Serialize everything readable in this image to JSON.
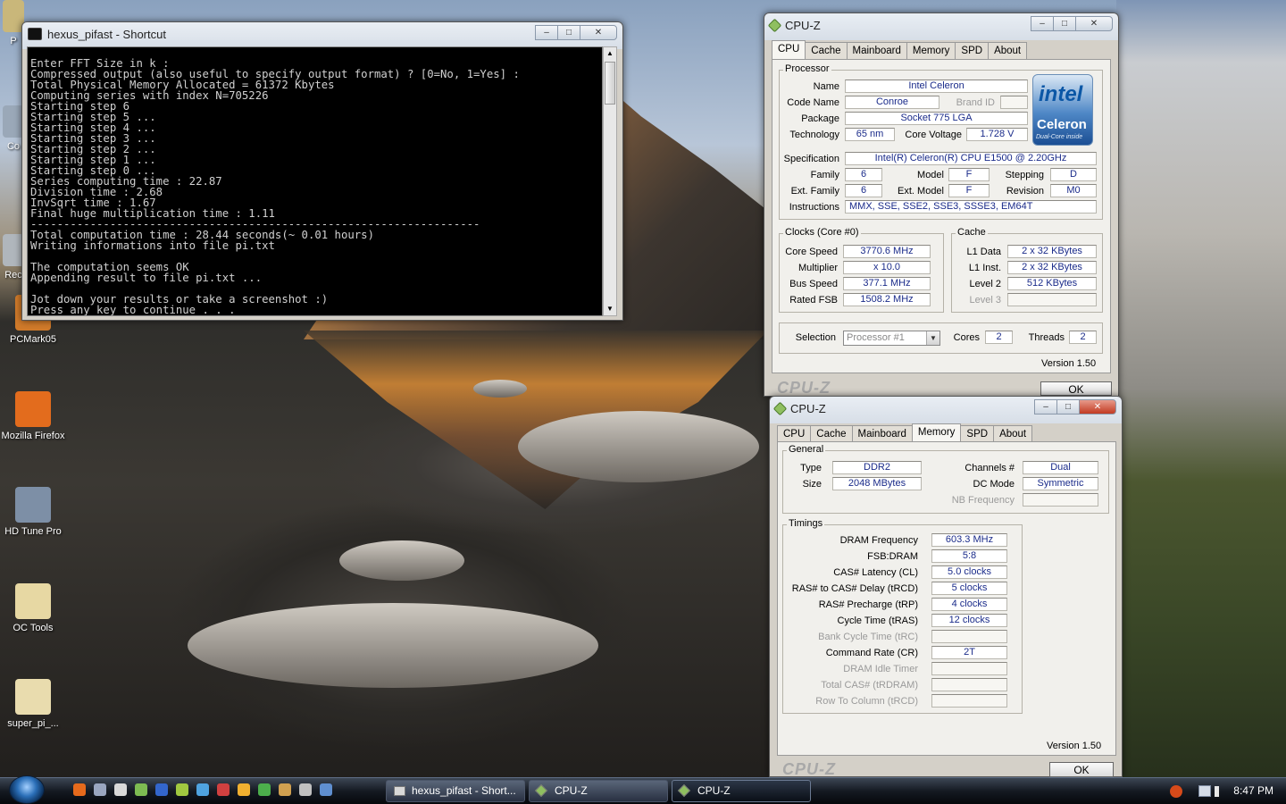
{
  "desktop": {
    "icons": [
      {
        "label": "P",
        "color": "#c9b77a"
      },
      {
        "label": "Co",
        "color": "#9aa8b8"
      },
      {
        "label": "Rec",
        "color": "#b0b6bc"
      },
      {
        "label": "PCMark05",
        "color": "#d07a2a"
      },
      {
        "label": "Mozilla Firefox",
        "color": "#e36c1d"
      },
      {
        "label": "HD Tune Pro",
        "color": "#7d8fa6"
      },
      {
        "label": "OC Tools",
        "color": "#e7d8a3"
      },
      {
        "label": "super_pi_...",
        "color": "#e9dcae"
      }
    ]
  },
  "console_window": {
    "title": "hexus_pifast - Shortcut",
    "lines": [
      "Enter FFT Size in k :",
      "Compressed output (also useful to specify output format) ? [0=No, 1=Yes] :",
      "Total Physical Memory Allocated = 61372 Kbytes",
      "Computing series with index N=705226",
      "Starting step 6",
      "Starting step 5 ...",
      "Starting step 4 ...",
      "Starting step 3 ...",
      "Starting step 2 ...",
      "Starting step 1 ...",
      "Starting step 0 ...",
      "Series computing time : 22.87",
      "Division time : 2.68",
      "InvSqrt time : 1.67",
      "Final huge multiplication time : 1.11",
      "--------------------------------------------------------------------",
      "Total computation time : 28.44 seconds(~ 0.01 hours)",
      "Writing informations into file pi.txt",
      "",
      "The computation seems OK",
      "Appending result to file pi.txt ...",
      "",
      "Jot down your results or take a screenshot :)",
      "Press any key to continue . . ."
    ]
  },
  "cpuz_cpu": {
    "title": "CPU-Z",
    "tabs": [
      "CPU",
      "Cache",
      "Mainboard",
      "Memory",
      "SPD",
      "About"
    ],
    "active_tab": "CPU",
    "processor": {
      "group": "Processor",
      "name_label": "Name",
      "name": "Intel Celeron",
      "codename_label": "Code Name",
      "codename": "Conroe",
      "brandid_label": "Brand ID",
      "brandid": "",
      "package_label": "Package",
      "package": "Socket 775 LGA",
      "technology_label": "Technology",
      "technology": "65 nm",
      "corevoltage_label": "Core Voltage",
      "corevoltage": "1.728 V",
      "spec_label": "Specification",
      "spec": "Intel(R) Celeron(R) CPU        E1500  @ 2.20GHz",
      "family_label": "Family",
      "family": "6",
      "model_label": "Model",
      "model": "F",
      "stepping_label": "Stepping",
      "stepping": "D",
      "extfamily_label": "Ext. Family",
      "extfamily": "6",
      "extmodel_label": "Ext. Model",
      "extmodel": "F",
      "revision_label": "Revision",
      "revision": "M0",
      "instructions_label": "Instructions",
      "instructions": "MMX, SSE, SSE2, SSE3, SSSE3, EM64T"
    },
    "logo": {
      "brand": "intel",
      "product": "Celeron",
      "tagline": "Dual-Core inside"
    },
    "clocks": {
      "group": "Clocks (Core #0)",
      "corespeed_label": "Core Speed",
      "corespeed": "3770.6 MHz",
      "multiplier_label": "Multiplier",
      "multiplier": "x 10.0",
      "busspeed_label": "Bus Speed",
      "busspeed": "377.1 MHz",
      "ratedfsb_label": "Rated FSB",
      "ratedfsb": "1508.2 MHz"
    },
    "cache": {
      "group": "Cache",
      "l1data_label": "L1 Data",
      "l1data": "2 x 32 KBytes",
      "l1inst_label": "L1 Inst.",
      "l1inst": "2 x 32 KBytes",
      "level2_label": "Level 2",
      "level2": "512 KBytes",
      "level3_label": "Level 3",
      "level3": ""
    },
    "selection_label": "Selection",
    "selection": "Processor #1",
    "cores_label": "Cores",
    "cores": "2",
    "threads_label": "Threads",
    "threads": "2",
    "version": "Version 1.50",
    "brand_footer": "CPU-Z",
    "ok": "OK"
  },
  "cpuz_mem": {
    "title": "CPU-Z",
    "tabs": [
      "CPU",
      "Cache",
      "Mainboard",
      "Memory",
      "SPD",
      "About"
    ],
    "active_tab": "Memory",
    "general": {
      "group": "General",
      "type_label": "Type",
      "type": "DDR2",
      "size_label": "Size",
      "size": "2048 MBytes",
      "channels_label": "Channels #",
      "channels": "Dual",
      "dcmode_label": "DC Mode",
      "dcmode": "Symmetric",
      "nbfreq_label": "NB Frequency",
      "nbfreq": ""
    },
    "timings": {
      "group": "Timings",
      "rows": [
        {
          "label": "DRAM Frequency",
          "value": "603.3 MHz",
          "enabled": true
        },
        {
          "label": "FSB:DRAM",
          "value": "5:8",
          "enabled": true
        },
        {
          "label": "CAS# Latency (CL)",
          "value": "5.0 clocks",
          "enabled": true
        },
        {
          "label": "RAS# to CAS# Delay (tRCD)",
          "value": "5 clocks",
          "enabled": true
        },
        {
          "label": "RAS# Precharge (tRP)",
          "value": "4 clocks",
          "enabled": true
        },
        {
          "label": "Cycle Time (tRAS)",
          "value": "12 clocks",
          "enabled": true
        },
        {
          "label": "Bank Cycle Time (tRC)",
          "value": "",
          "enabled": false
        },
        {
          "label": "Command Rate (CR)",
          "value": "2T",
          "enabled": true
        },
        {
          "label": "DRAM Idle Timer",
          "value": "",
          "enabled": false
        },
        {
          "label": "Total CAS# (tRDRAM)",
          "value": "",
          "enabled": false
        },
        {
          "label": "Row To Column (tRCD)",
          "value": "",
          "enabled": false
        }
      ]
    },
    "version": "Version 1.50",
    "brand_footer": "CPU-Z",
    "ok": "OK"
  },
  "taskbar": {
    "buttons": [
      {
        "label": "hexus_pifast - Short...",
        "active": false
      },
      {
        "label": "CPU-Z",
        "active": false
      },
      {
        "label": "CPU-Z",
        "active": true
      }
    ],
    "clock": "8:47 PM",
    "quicklaunch_colors": [
      "#e66a1c",
      "#9aa6c0",
      "#d9d9d9",
      "#7dbb52",
      "#3366cc",
      "#a0c840",
      "#4fa3e0",
      "#d04040",
      "#f0b030",
      "#4cae4c",
      "#d0a050",
      "#c0c0c0",
      "#5f8fd0"
    ]
  }
}
